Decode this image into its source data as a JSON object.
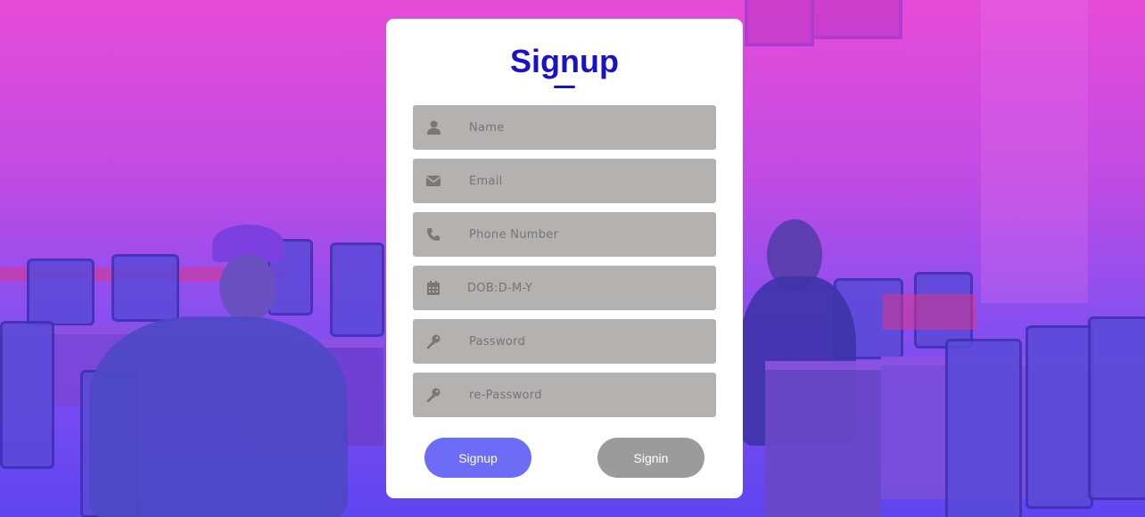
{
  "form": {
    "title": "Signup",
    "fields": [
      {
        "placeholder": "Name",
        "icon": "user-icon"
      },
      {
        "placeholder": "Email",
        "icon": "envelope-icon"
      },
      {
        "placeholder": "Phone Number",
        "icon": "phone-icon"
      },
      {
        "placeholder": "DOB:D-M-Y",
        "icon": "calendar-icon"
      },
      {
        "placeholder": "Password",
        "icon": "key-icon"
      },
      {
        "placeholder": "re-Password",
        "icon": "key-icon"
      }
    ],
    "signup_label": "Signup",
    "signin_label": "Signin"
  },
  "colors": {
    "title": "#1a12c8",
    "field_bg": "#b4b1b1",
    "signup_button": "#6c6cf6",
    "signin_button": "#9c9b9b"
  }
}
